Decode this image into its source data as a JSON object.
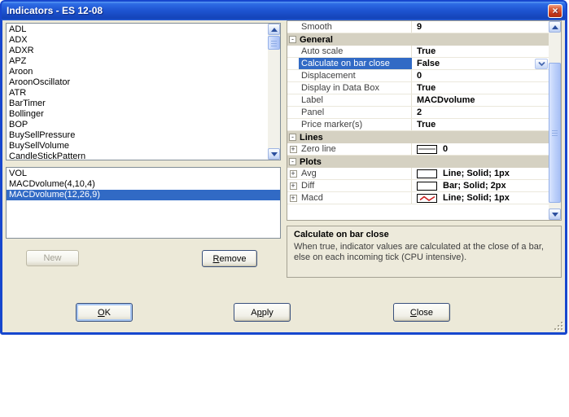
{
  "window": {
    "title": "Indicators - ES 12-08",
    "close_glyph": "×"
  },
  "indicator_list": {
    "items": [
      "ADL",
      "ADX",
      "ADXR",
      "APZ",
      "Aroon",
      "AroonOscillator",
      "ATR",
      "BarTimer",
      "Bollinger",
      "BOP",
      "BuySellPressure",
      "BuySellVolume",
      "CandleStickPattern"
    ]
  },
  "applied_list": {
    "items": [
      {
        "label": "VOL",
        "selected": false
      },
      {
        "label": "MACDvolume(4,10,4)",
        "selected": false
      },
      {
        "label": "MACDvolume(12,26,9)",
        "selected": true
      }
    ],
    "new_button": {
      "label": "New",
      "mnemonic": -1
    },
    "remove_button": {
      "label": "Remove",
      "mnemonic": 0
    }
  },
  "property_grid": {
    "rows": [
      {
        "type": "item",
        "name": "Smooth",
        "value": "9"
      },
      {
        "type": "category",
        "name": "General"
      },
      {
        "type": "item",
        "name": "Auto scale",
        "value": "True"
      },
      {
        "type": "item",
        "name": "Calculate on bar close",
        "value": "False",
        "selected": true,
        "dropdown": true
      },
      {
        "type": "item",
        "name": "Displacement",
        "value": "0"
      },
      {
        "type": "item",
        "name": "Display in Data Box",
        "value": "True"
      },
      {
        "type": "item",
        "name": "Label",
        "value": "MACDvolume"
      },
      {
        "type": "item",
        "name": "Panel",
        "value": "2"
      },
      {
        "type": "item",
        "name": "Price marker(s)",
        "value": "True"
      },
      {
        "type": "category",
        "name": "Lines"
      },
      {
        "type": "item",
        "name": "Zero line",
        "value": "0",
        "expandable": true,
        "swatch": "line-sample"
      },
      {
        "type": "category",
        "name": "Plots"
      },
      {
        "type": "item",
        "name": "Avg",
        "value": "Line; Solid; 1px",
        "expandable": true,
        "swatch": "empty"
      },
      {
        "type": "item",
        "name": "Diff",
        "value": "Bar; Solid; 2px",
        "expandable": true,
        "swatch": "empty"
      },
      {
        "type": "item",
        "name": "Macd",
        "value": "Line; Solid; 1px",
        "expandable": true,
        "swatch": "zigzag"
      }
    ]
  },
  "description": {
    "title": "Calculate on bar close",
    "text": "When true, indicator values are calculated at the close of a bar, else on each incoming tick (CPU intensive)."
  },
  "action_buttons": {
    "ok": {
      "label": "OK",
      "mnemonic": 0
    },
    "apply": {
      "label": "Apply",
      "mnemonic": 1
    },
    "close": {
      "label": "Close",
      "mnemonic": 0
    }
  },
  "colors": {
    "titlebar_blue": "#1E55D2",
    "selection_blue": "#316AC5",
    "dialog_bg": "#ECE9D8",
    "category_bg": "#D5D1C2",
    "macd_red": "#CC2020"
  }
}
